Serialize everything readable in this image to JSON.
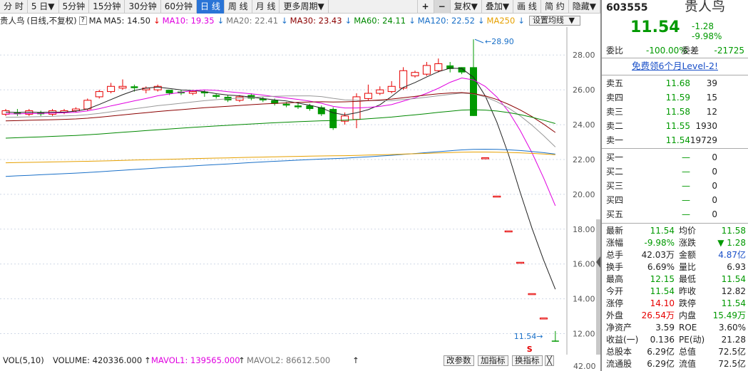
{
  "toolbar": {
    "items": [
      "分 时",
      "5 日▼",
      "5分钟",
      "15分钟",
      "30分钟",
      "60分钟",
      "日 线",
      "周 线",
      "月 线",
      "更多周期▼"
    ],
    "active_index": 6,
    "right_items": [
      "+",
      "−",
      "复权▼",
      "叠加▼",
      "画 线",
      "简 约",
      "隐藏▼"
    ]
  },
  "ma_bar": {
    "name": "贵人鸟",
    "mode": "(日线,不复权)",
    "q": "?",
    "ma_label": "MA",
    "items": [
      {
        "label": "MA5: 14.50",
        "color": "#222222"
      },
      {
        "label": "MA10: 19.35",
        "color": "#e000e0"
      },
      {
        "label": "MA20: 22.41",
        "color": "#777777"
      },
      {
        "label": "MA30: 23.43",
        "color": "#8b0000"
      },
      {
        "label": "MA60: 24.11",
        "color": "#008800"
      },
      {
        "label": "MA120: 22.52",
        "color": "#1a70c8"
      },
      {
        "label": "MA250",
        "color": "#e6a000"
      }
    ],
    "settings": "设置均线",
    "settings_arrow": "▼"
  },
  "price_axis": [
    "28.00",
    "26.00",
    "24.00",
    "22.00",
    "20.00",
    "18.00",
    "16.00",
    "14.00",
    "12.00"
  ],
  "price_range": [
    11.0,
    29.4
  ],
  "annotations": {
    "high": "28.90",
    "low": "11.54",
    "s_mark": "S"
  },
  "chart_data": {
    "type": "candlestick",
    "ylim": [
      11.0,
      29.4
    ],
    "candles": [
      [
        24.6,
        24.8,
        24.9,
        24.5
      ],
      [
        24.7,
        24.6,
        24.9,
        24.5
      ],
      [
        24.6,
        24.8,
        24.9,
        24.5
      ],
      [
        24.7,
        24.6,
        24.8,
        24.5
      ],
      [
        24.6,
        24.8,
        24.9,
        24.5
      ],
      [
        24.7,
        24.8,
        24.9,
        24.6
      ],
      [
        24.8,
        24.9,
        25.0,
        24.7
      ],
      [
        24.9,
        25.4,
        25.5,
        24.8
      ],
      [
        25.6,
        25.9,
        26.0,
        25.5
      ],
      [
        25.9,
        26.2,
        26.4,
        25.8
      ],
      [
        26.1,
        26.2,
        26.6,
        26.0
      ],
      [
        26.2,
        26.1,
        26.3,
        25.9
      ],
      [
        26.0,
        26.1,
        26.2,
        25.8
      ],
      [
        26.0,
        26.2,
        26.3,
        25.9
      ],
      [
        26.0,
        25.8,
        26.0,
        25.7
      ],
      [
        25.9,
        25.8,
        26.0,
        25.7
      ],
      [
        25.8,
        25.9,
        26.0,
        25.7
      ],
      [
        25.9,
        25.8,
        26.0,
        25.6
      ],
      [
        25.7,
        25.6,
        25.8,
        25.5
      ],
      [
        25.6,
        25.4,
        25.7,
        25.3
      ],
      [
        25.4,
        25.6,
        25.7,
        25.3
      ],
      [
        25.7,
        25.5,
        25.8,
        25.4
      ],
      [
        25.5,
        25.4,
        25.6,
        25.3
      ],
      [
        25.4,
        25.2,
        25.5,
        25.1
      ],
      [
        25.2,
        25.1,
        25.3,
        25.0
      ],
      [
        25.1,
        25.0,
        25.3,
        24.9
      ],
      [
        25.1,
        24.9,
        25.2,
        24.8
      ],
      [
        25.0,
        24.6,
        25.1,
        24.5
      ],
      [
        24.9,
        23.8,
        25.0,
        23.7
      ],
      [
        24.2,
        24.5,
        24.7,
        24.0
      ],
      [
        24.3,
        25.6,
        25.8,
        23.8
      ],
      [
        25.5,
        25.8,
        26.3,
        25.4
      ],
      [
        25.8,
        26.0,
        26.2,
        25.7
      ],
      [
        25.9,
        26.2,
        26.5,
        25.8
      ],
      [
        26.1,
        27.1,
        27.3,
        26.0
      ],
      [
        26.8,
        27.0,
        27.1,
        26.7
      ],
      [
        26.9,
        27.4,
        27.6,
        26.8
      ],
      [
        27.1,
        27.5,
        27.8,
        27.0
      ],
      [
        27.4,
        27.2,
        27.6,
        27.0
      ],
      [
        27.3,
        27.0,
        27.3,
        26.9
      ],
      [
        27.3,
        24.5,
        28.9,
        24.5
      ],
      [
        22.1,
        22.1,
        22.1,
        22.1
      ],
      [
        19.9,
        19.9,
        19.9,
        19.9
      ],
      [
        17.9,
        17.9,
        17.9,
        17.9
      ],
      [
        16.1,
        16.1,
        16.1,
        16.1
      ],
      [
        14.3,
        14.3,
        14.3,
        14.3
      ],
      [
        12.9,
        12.9,
        12.9,
        12.9
      ],
      [
        11.6,
        11.54,
        12.15,
        11.54
      ]
    ]
  },
  "volume_bar": {
    "vol_label": "VOL(5,10)",
    "volume": "VOLUME: 420336.000",
    "mavol1": "MAVOL1: 139565.000",
    "mavol2": "MAVOL2: 86612.500",
    "buttons": [
      "改参数",
      "加指标",
      "换指标"
    ],
    "close": "╳",
    "axis_label": "42.00"
  },
  "side": {
    "code": "603555",
    "name": "贵人鸟",
    "price": "11.54",
    "change": "-1.28",
    "change_pct": "-9.98%",
    "weibi_label": "委比",
    "weibi": "-100.00%",
    "weicha_label": "委差",
    "weicha": "-21725",
    "promo": "免费领6个月Level-2!",
    "asks": [
      {
        "label": "卖五",
        "price": "11.68",
        "vol": "39"
      },
      {
        "label": "卖四",
        "price": "11.59",
        "vol": "15"
      },
      {
        "label": "卖三",
        "price": "11.58",
        "vol": "12"
      },
      {
        "label": "卖二",
        "price": "11.55",
        "vol": "1930"
      },
      {
        "label": "卖一",
        "price": "11.54",
        "vol": "19729"
      }
    ],
    "bids": [
      {
        "label": "买一",
        "price": "—",
        "vol": "0"
      },
      {
        "label": "买二",
        "price": "—",
        "vol": "0"
      },
      {
        "label": "买三",
        "price": "—",
        "vol": "0"
      },
      {
        "label": "买四",
        "price": "—",
        "vol": "0"
      },
      {
        "label": "买五",
        "price": "—",
        "vol": "0"
      }
    ],
    "stats": [
      [
        "最新",
        "11.54",
        "均价",
        "11.58"
      ],
      [
        "涨幅",
        "-9.98%",
        "涨跌",
        "▼ 1.28"
      ],
      [
        "总手",
        "42.03万",
        "金额",
        "4.87亿"
      ],
      [
        "换手",
        "6.69%",
        "量比",
        "6.93"
      ],
      [
        "最高",
        "12.15",
        "最低",
        "11.54"
      ],
      [
        "今开",
        "11.54",
        "昨收",
        "12.82"
      ],
      [
        "涨停",
        "14.10",
        "跌停",
        "11.54"
      ],
      [
        "外盘",
        "26.54万",
        "内盘",
        "15.49万"
      ],
      [
        "净资产",
        "3.59",
        "ROE",
        "3.60%"
      ],
      [
        "收益(一)",
        "0.136",
        "PE(动)",
        "21.28"
      ],
      [
        "总股本",
        "6.29亿",
        "总值",
        "72.5亿"
      ],
      [
        "流通股",
        "6.29亿",
        "流值",
        "72.5亿"
      ]
    ],
    "colors": {
      "up": "#e60000",
      "down": "#009900",
      "blue": "#1a50c8"
    }
  }
}
